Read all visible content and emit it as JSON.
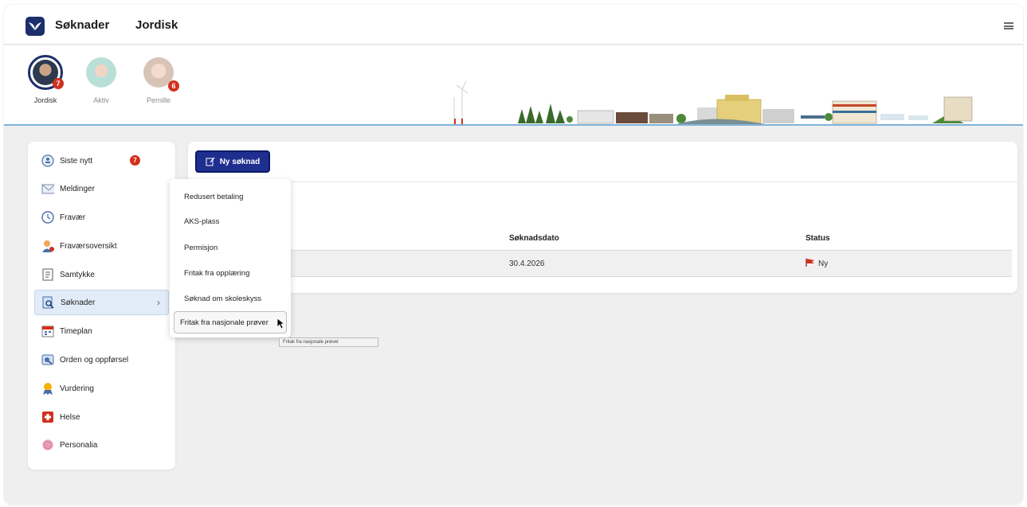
{
  "header": {
    "app_title": "Søknader",
    "user_title": "Jordisk",
    "logo_icon": "app-logo-icon",
    "menu_icon": "hamburger-menu-icon"
  },
  "profiles": [
    {
      "name": "Jordisk",
      "badge": "7",
      "active": true
    },
    {
      "name": "Aktiv",
      "badge": "",
      "active": false
    },
    {
      "name": "Pernille",
      "badge": "6",
      "active": false
    }
  ],
  "sidebar": {
    "items": [
      {
        "label": "Siste nytt",
        "icon": "news-icon",
        "badge": "7"
      },
      {
        "label": "Meldinger",
        "icon": "envelope-icon"
      },
      {
        "label": "Fravær",
        "icon": "clock-icon"
      },
      {
        "label": "Fraværsoversikt",
        "icon": "person-icon"
      },
      {
        "label": "Samtykke",
        "icon": "form-icon"
      },
      {
        "label": "Søknader",
        "icon": "search-document-icon",
        "active": true,
        "chevron": "›"
      },
      {
        "label": "Timeplan",
        "icon": "calendar-icon"
      },
      {
        "label": "Orden og oppførsel",
        "icon": "conduct-icon"
      },
      {
        "label": "Vurdering",
        "icon": "medal-icon"
      },
      {
        "label": "Helse",
        "icon": "health-cross-icon"
      },
      {
        "label": "Personalia",
        "icon": "fingerprint-icon"
      }
    ]
  },
  "main": {
    "new_button": "Ny søknad",
    "columns": {
      "date": "Søknadsdato",
      "status": "Status"
    },
    "rows": [
      {
        "date": "30.4.2026",
        "status": "Ny",
        "status_icon": "red-flag-icon"
      }
    ]
  },
  "dropdown": {
    "items": [
      "Redusert betaling",
      "AKS-plass",
      "Permisjon",
      "Fritak fra opplæring",
      "Søknad om skoleskyss",
      "Fritak fra nasjonale prøver"
    ],
    "hovered_index": 5,
    "tooltip": "Fritak fra nasjonale prøver"
  },
  "colors": {
    "brand": "#1c2f6b",
    "button": "#1f2f8f",
    "badge": "#d0311f",
    "active_nav": "#e1ecf8"
  }
}
